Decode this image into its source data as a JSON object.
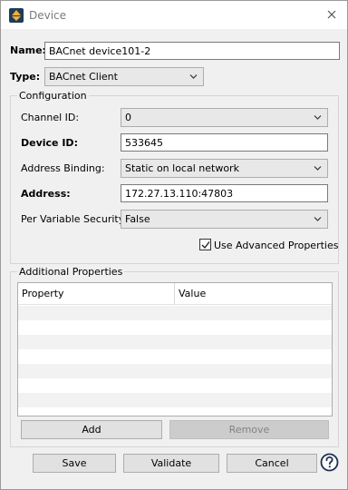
{
  "window": {
    "title": "Device",
    "close_icon": "close-icon",
    "app_icon": "up-down-arrows-icon"
  },
  "form": {
    "name_label": "Name:",
    "name_value": "BACnet device101-2",
    "type_label": "Type:",
    "type_value": "BACnet Client"
  },
  "configuration": {
    "title": "Configuration",
    "channel_id_label": "Channel ID:",
    "channel_id_value": "0",
    "device_id_label": "Device ID:",
    "device_id_value": "533645",
    "address_binding_label": "Address Binding:",
    "address_binding_value": "Static on local network",
    "address_label": "Address:",
    "address_value": "172.27.13.110:47803",
    "per_variable_security_label": "Per Variable Security:",
    "per_variable_security_value": "False",
    "use_advanced_label": "Use Advanced Properties",
    "use_advanced_checked": true
  },
  "additional_properties": {
    "title": "Additional Properties",
    "columns": [
      "Property",
      "Value"
    ],
    "rows": [],
    "add_label": "Add",
    "remove_label": "Remove"
  },
  "footer": {
    "save_label": "Save",
    "validate_label": "Validate",
    "cancel_label": "Cancel",
    "help_icon": "help-icon"
  },
  "colors": {
    "title_text": "#7a7a7a",
    "disabled_button": "#cccccc"
  }
}
